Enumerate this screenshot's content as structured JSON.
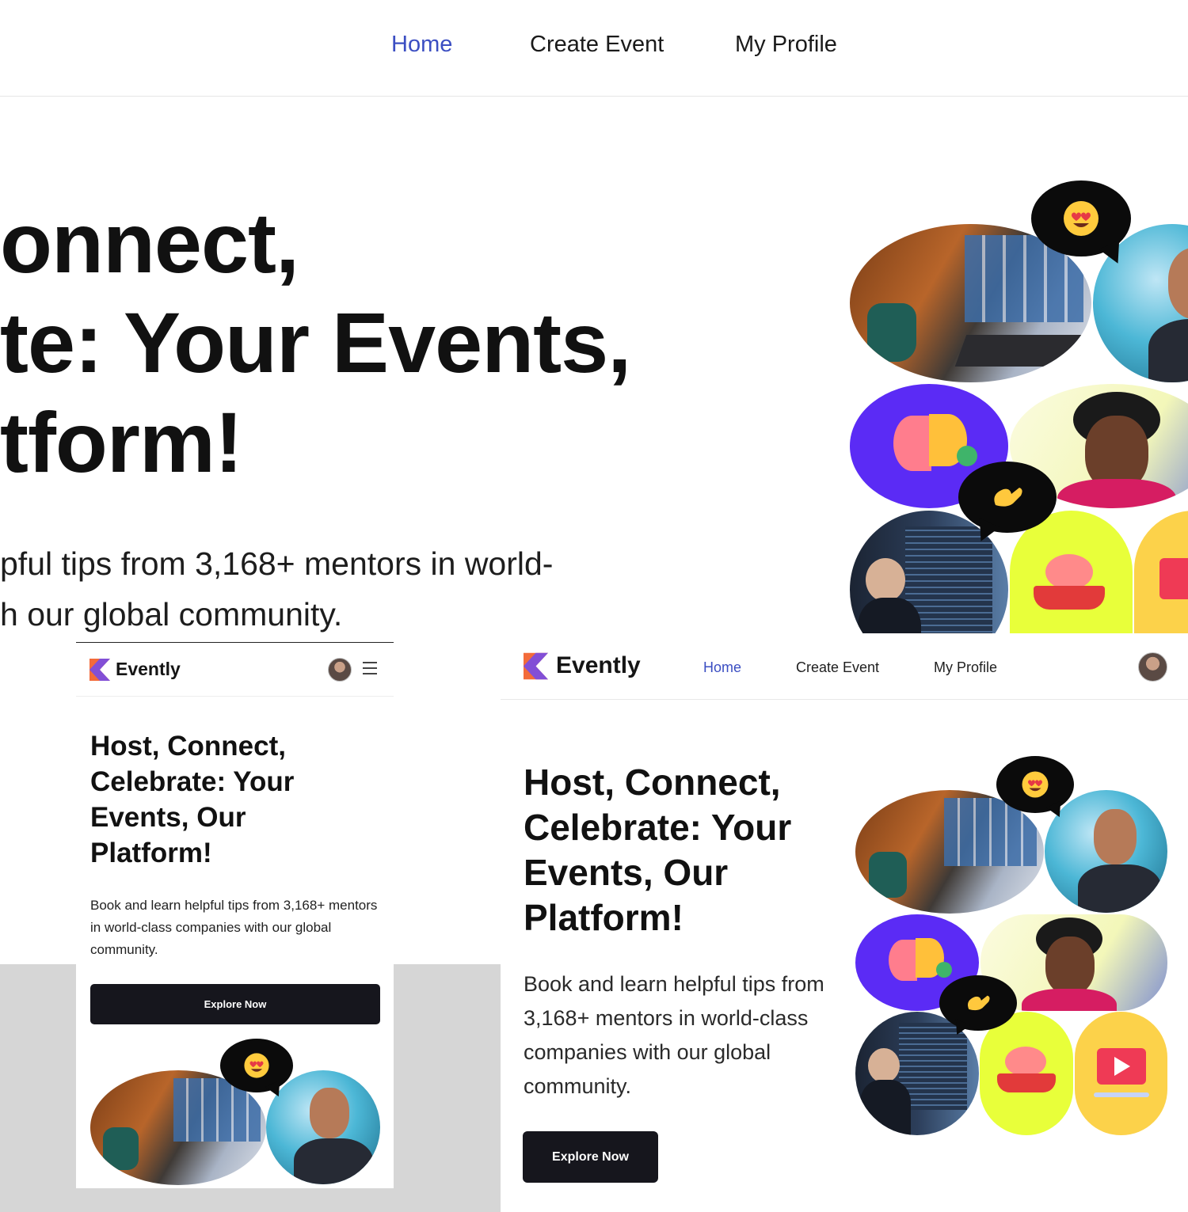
{
  "zoom": {
    "nav": {
      "home": "Home",
      "create_event": "Create Event",
      "my_profile": "My Profile"
    },
    "title": "Host, Connect, Celebrate: Your Events, Our Platform!",
    "title_lines": [
      "onnect,",
      "te: Your Events,",
      "tform!"
    ],
    "subtitle_lines": [
      "pful tips from 3,168+ mentors in world-",
      "h our global community."
    ]
  },
  "mobile": {
    "brand": "Evently",
    "title": "Host, Connect, Celebrate: Your Events, Our Platform!",
    "subtitle": "Book and learn helpful tips from 3,168+ mentors in world-class companies with our global community.",
    "cta": "Explore Now"
  },
  "desktop": {
    "brand": "Evently",
    "nav": {
      "home": "Home",
      "create_event": "Create Event",
      "my_profile": "My Profile"
    },
    "title": "Host, Connect, Celebrate: Your Events, Our Platform!",
    "subtitle": "Book and learn helpful tips from 3,168+ mentors in world-class companies with our global community.",
    "cta": "Explore Now"
  },
  "icons": {
    "logo": "evently-logo-icon",
    "heart_eyes": "heart-eyes-emoji-icon",
    "pinch_hand": "pinching-hand-emoji-icon",
    "menu": "menu-icon",
    "play": "play-icon",
    "brain_book": "brain-book-icon",
    "brain_bulb": "brain-lightbulb-icon"
  },
  "colors": {
    "accent": "#3b4ec2",
    "button": "#16161d",
    "purple": "#5b2bf5",
    "lime": "#e8ff3a",
    "yellow": "#fcd24a",
    "logo_orange": "#f36b3a",
    "logo_purple": "#6d4af2"
  }
}
